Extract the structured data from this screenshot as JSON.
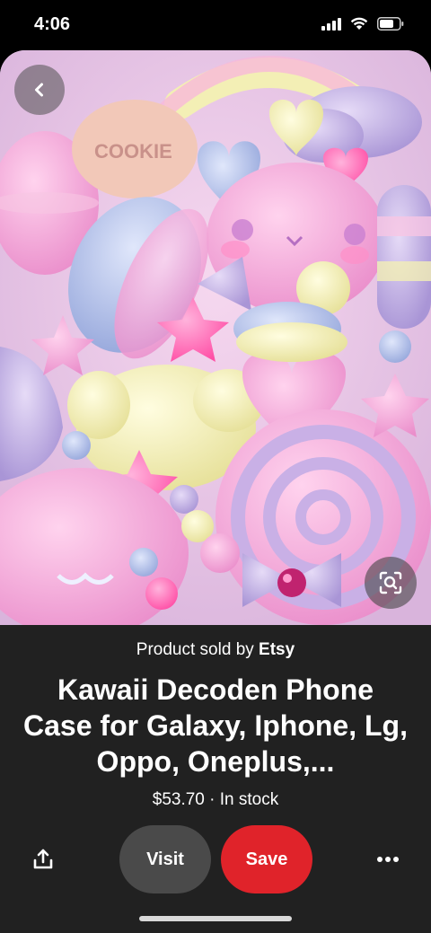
{
  "status_bar": {
    "time": "4:06",
    "icons": [
      "signal-icon",
      "wifi-icon",
      "battery-icon"
    ]
  },
  "image": {
    "description_icon": "product-photo",
    "cookie_text": "COOKIE",
    "colors": {
      "pink": "#f3a7d6",
      "lavender": "#b9a8e0",
      "yellow": "#f3f0b2",
      "blue": "#a9b8e4",
      "hot_pink": "#ff6bb5"
    }
  },
  "product": {
    "sold_by_prefix": "Product sold by",
    "seller": "Etsy",
    "title_line1": "Kawaii Decoden Phone",
    "title_line2": "Case for Galaxy, Iphone, Lg,",
    "title_line3": "Oppo, Oneplus,...",
    "price": "$53.70",
    "separator": "·",
    "stock": "In stock"
  },
  "actions": {
    "visit_label": "Visit",
    "save_label": "Save"
  },
  "colors": {
    "save_red": "#e0232a",
    "visit_gray": "#4a4a4a",
    "panel_bg": "#212121"
  }
}
